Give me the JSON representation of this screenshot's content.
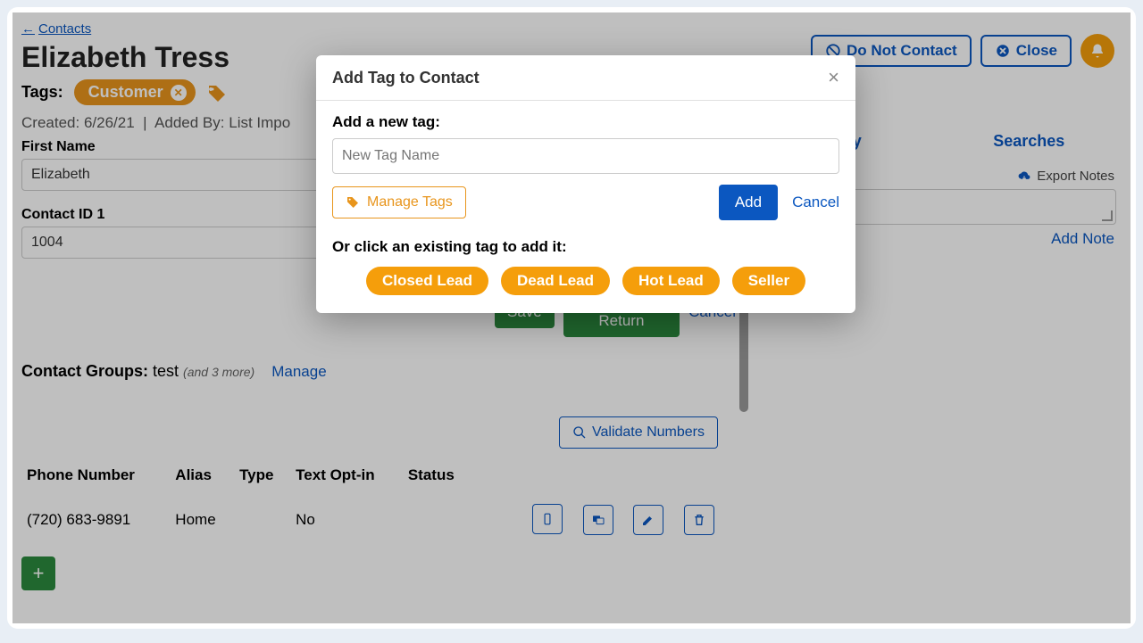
{
  "header": {
    "back_label": "Contacts",
    "contact_name": "Elizabeth Tress",
    "do_not_contact": "Do Not Contact",
    "close": "Close"
  },
  "tags": {
    "label": "Tags:",
    "primary": "Customer"
  },
  "meta": {
    "created_prefix": "Created:",
    "created_value": "6/26/21",
    "added_by_prefix": "Added By:",
    "added_by_value": "List Impo"
  },
  "form": {
    "first_name_label": "First Name",
    "first_name_value": "Elizabeth",
    "contact_id_label": "Contact ID 1",
    "contact_id_value": "1004",
    "save": "Save",
    "save_return": "Save & Return",
    "cancel": "Cancel"
  },
  "groups": {
    "label": "Contact Groups:",
    "value": "test",
    "more": "(and 3 more)",
    "manage": "Manage"
  },
  "phones": {
    "validate": "Validate Numbers",
    "columns": [
      "Phone Number",
      "Alias",
      "Type",
      "Text Opt-in",
      "Status"
    ],
    "rows": [
      {
        "number": "(720) 683-9891",
        "alias": "Home",
        "type": "",
        "optin": "No",
        "status": ""
      }
    ]
  },
  "right": {
    "tabs": [
      "Activity",
      "Searches"
    ],
    "export_notes": "Export Notes",
    "add_note": "Add Note",
    "no_notes": "(no notes)"
  },
  "modal": {
    "title": "Add Tag to Contact",
    "add_tag_label": "Add a new tag:",
    "placeholder": "New Tag Name",
    "manage_tags": "Manage Tags",
    "add": "Add",
    "cancel": "Cancel",
    "existing_label": "Or click an existing tag to add it:",
    "existing": [
      "Closed Lead",
      "Dead Lead",
      "Hot Lead",
      "Seller"
    ]
  }
}
